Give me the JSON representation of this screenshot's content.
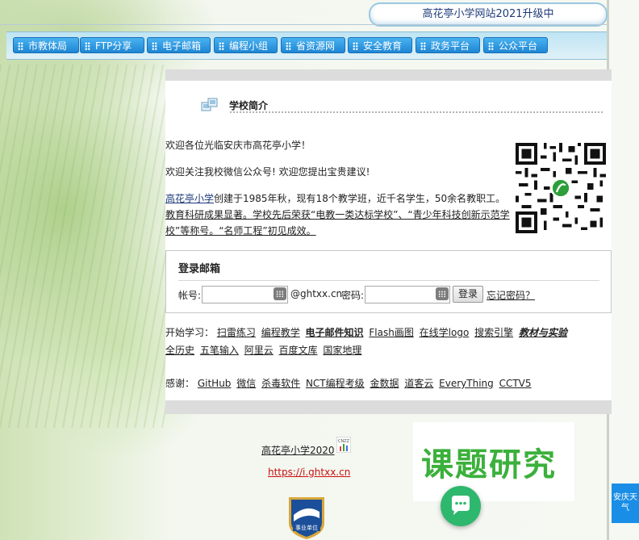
{
  "header": {
    "site_title": "高花亭小学网站2021升级中"
  },
  "nav": {
    "items": [
      {
        "label": "市教体局"
      },
      {
        "label": "FTP分享"
      },
      {
        "label": "电子邮箱"
      },
      {
        "label": "编程小组"
      },
      {
        "label": "省资源网"
      },
      {
        "label": "安全教育"
      },
      {
        "label": "政务平台"
      },
      {
        "label": "公众平台"
      }
    ]
  },
  "intro": {
    "section_title": "学校简介",
    "welcome": "欢迎各位光临安庆市高花亭小学！",
    "wechat": "欢迎关注我校微信公众号! 欢迎您提出宝贵建议!",
    "school_name_link": "高花亭小学",
    "body_part1": "创建于1985年秋，现有18个教学班，近千名学生，50余名教职工。",
    "body_part2": "教育科研成果显著。学校先后荣获“电教一类达标学校”、“青少年科技创新示范学校”等称号。“名师工程”初见成效。"
  },
  "login": {
    "title": "登录邮箱",
    "account_label": "帐号:",
    "domain_suffix": "@ghtxx.cn",
    "password_label": "密码:",
    "login_button": "登录",
    "forgot_link": "忘记密码？"
  },
  "learning": {
    "prefix": "开始学习：",
    "items": [
      {
        "label": "扫雷练习",
        "style": "normal"
      },
      {
        "label": "编程教学",
        "style": "normal"
      },
      {
        "label": "电子邮件知识",
        "style": "red"
      },
      {
        "label": "Flash画图",
        "style": "normal"
      },
      {
        "label": "在线学logo",
        "style": "normal"
      },
      {
        "label": "搜索引擎",
        "style": "normal"
      },
      {
        "label": "教材与实验",
        "style": "red-italic"
      }
    ],
    "items_line2": [
      {
        "label": "全历史"
      },
      {
        "label": "五笔输入"
      },
      {
        "label": "阿里云"
      },
      {
        "label": "百度文库"
      },
      {
        "label": "国家地理"
      }
    ]
  },
  "thanks": {
    "prefix": "感谢：",
    "items": [
      {
        "label": "GitHub"
      },
      {
        "label": "微信"
      },
      {
        "label": "杀毒软件"
      },
      {
        "label": "NCT编程考级"
      },
      {
        "label": "金数据"
      },
      {
        "label": "道客云"
      },
      {
        "label": "EveryThing"
      },
      {
        "label": "CCTV5"
      }
    ]
  },
  "footer": {
    "copyright_link": "高花亭小学2020",
    "url_link": "https://i.ghtxx.cn",
    "badge_label": "事业单位",
    "cnzz_label": "CNZZ"
  },
  "widgets": {
    "research_banner": "课题研究",
    "weather_button": "安庆天气",
    "chat_icon": "chat-bubble-icon"
  },
  "colors": {
    "nav_button": "#2a96e0",
    "title_text": "#1c3a7a",
    "highlight_red": "#d20000",
    "research_green": "#3bb03b",
    "chat_green": "#2eb86d",
    "weather_blue": "#1a8ee6"
  }
}
